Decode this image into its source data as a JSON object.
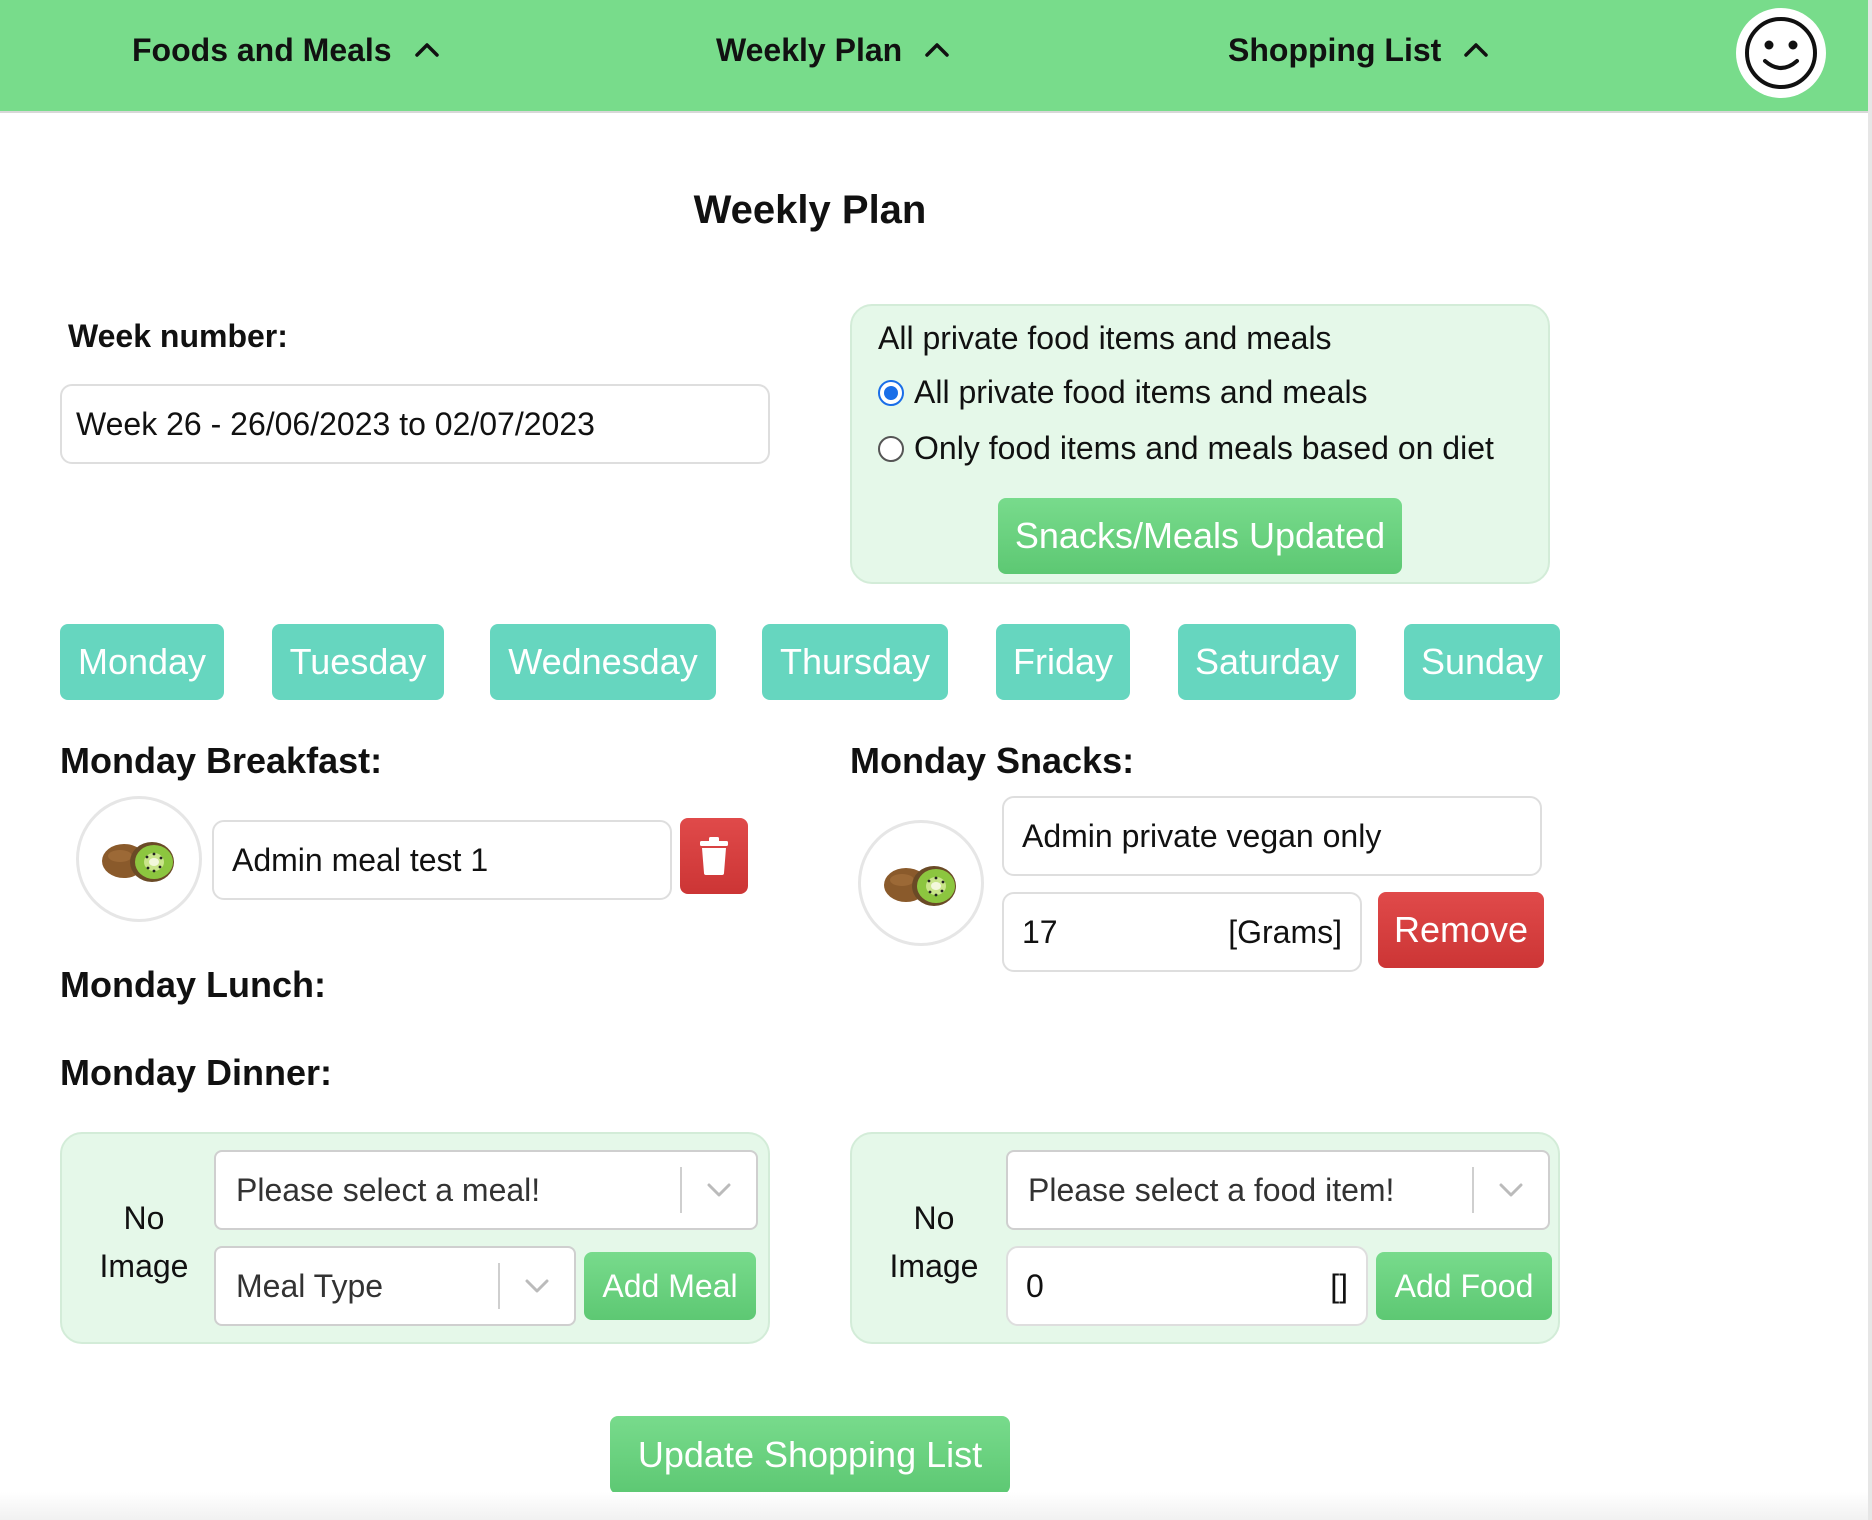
{
  "nav": {
    "items": [
      {
        "label": "Foods and Meals",
        "icon": "chevron-up-icon"
      },
      {
        "label": "Weekly Plan",
        "icon": "chevron-up-icon"
      },
      {
        "label": "Shopping List",
        "icon": "chevron-up-icon"
      }
    ],
    "avatar_icon": "smiley-face-icon",
    "bg_color": "#78dc8b"
  },
  "page_title": "Weekly Plan",
  "week": {
    "label": "Week number:",
    "value": "Week 26 - 26/06/2023 to 02/07/2023"
  },
  "filter_panel": {
    "title": "All private food items and meals",
    "options": [
      {
        "label": "All private food items and meals",
        "checked": true
      },
      {
        "label": "Only food items and meals based on diet",
        "checked": false
      }
    ],
    "button_label": "Snacks/Meals Updated"
  },
  "days": [
    "Monday",
    "Tuesday",
    "Wednesday",
    "Thursday",
    "Friday",
    "Saturday",
    "Sunday"
  ],
  "breakfast": {
    "heading": "Monday Breakfast:",
    "item_name": "Admin meal test 1",
    "image_icon": "kiwi-image",
    "delete_icon": "trash-icon"
  },
  "snacks": {
    "heading": "Monday Snacks:",
    "item_name": "Admin private vegan only",
    "quantity": "17",
    "unit": "[Grams]",
    "remove_label": "Remove",
    "image_icon": "kiwi-image"
  },
  "lunch": {
    "heading": "Monday Lunch:"
  },
  "dinner": {
    "heading": "Monday Dinner:"
  },
  "add_meal": {
    "no_image_line1": "No",
    "no_image_line2": "Image",
    "select_placeholder": "Please select a meal!",
    "meal_type_placeholder": "Meal Type",
    "button_label": "Add Meal"
  },
  "add_food": {
    "no_image_line1": "No",
    "no_image_line2": "Image",
    "select_placeholder": "Please select a food item!",
    "quantity": "0",
    "unit": "[]",
    "button_label": "Add Food"
  },
  "update_button": "Update Shopping List",
  "colors": {
    "green": "#78dc8b",
    "teal": "#66d6bf",
    "red": "#d83e3e",
    "panel_bg": "#e5f8e9"
  }
}
